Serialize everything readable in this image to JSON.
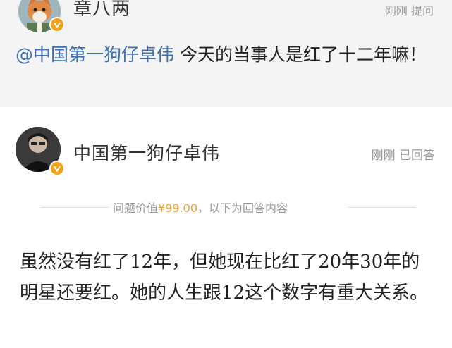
{
  "question": {
    "author_name": "章八两",
    "status": "刚刚 提问",
    "mention": "@中国第一狗仔卓伟",
    "text": " 今天的当事人是红了十二年嘛！"
  },
  "answer": {
    "author_name": "中国第一狗仔卓伟",
    "status": "刚刚 已回答",
    "price_prefix": "问题价值",
    "price": "¥99.00",
    "price_suffix": "，以下为回答内容",
    "text": "虽然没有红了12年，但她现在比红了20年30年的明星还要红。她的人生跟12这个数字有重大关系。"
  },
  "colors": {
    "mention": "#3c6fb6",
    "price": "#e8a03a",
    "badge": "#f3a218",
    "question_bg": "#f4f4f4"
  },
  "icons": {
    "question_avatar": "fox-avatar",
    "answer_avatar": "person-avatar",
    "verified_badge": "verified-badge-icon"
  }
}
